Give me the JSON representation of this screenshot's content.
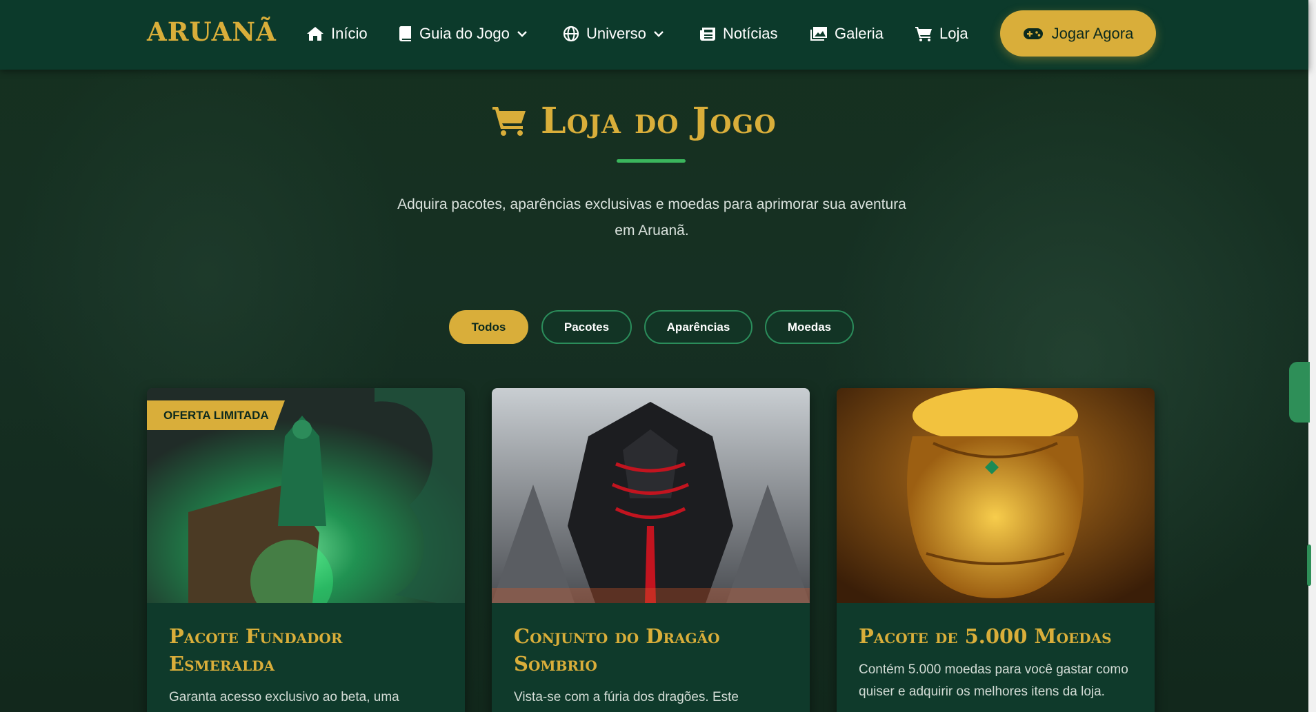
{
  "nav": {
    "logo": "ARUANÃ",
    "items": [
      {
        "label": "Início",
        "icon": "home-icon"
      },
      {
        "label": "Guia do Jogo",
        "icon": "book-icon"
      },
      {
        "label": "Universo",
        "icon": "globe-icon"
      },
      {
        "label": "Notícias",
        "icon": "newspaper-icon"
      },
      {
        "label": "Galeria",
        "icon": "images-icon"
      },
      {
        "label": "Loja",
        "icon": "cart-icon"
      }
    ],
    "cta": "Jogar Agora"
  },
  "hero": {
    "title": "Loja do Jogo",
    "subtitle": "Adquira pacotes, aparências exclusivas e moedas para aprimorar sua aventura em Aruanã."
  },
  "filters": [
    {
      "label": "Todos",
      "active": true
    },
    {
      "label": "Pacotes",
      "active": false
    },
    {
      "label": "Aparências",
      "active": false
    },
    {
      "label": "Moedas",
      "active": false
    }
  ],
  "products": [
    {
      "badge": "OFERTA LIMITADA",
      "title": "Pacote Fundador Esmeralda",
      "description": "Garanta acesso exclusivo ao beta, uma"
    },
    {
      "title": "Conjunto do Dragão Sombrio",
      "description": "Vista-se com a fúria dos dragões. Este"
    },
    {
      "title": "Pacote de 5.000 Moedas",
      "description": "Contém 5.000 moedas para você gastar como quiser e adquirir os melhores itens da loja."
    }
  ],
  "colors": {
    "accent_gold": "#d9ae3a",
    "nav_bg": "#0c3a2b",
    "page_bg": "#142a1f",
    "accent_green": "#3bb65d"
  }
}
